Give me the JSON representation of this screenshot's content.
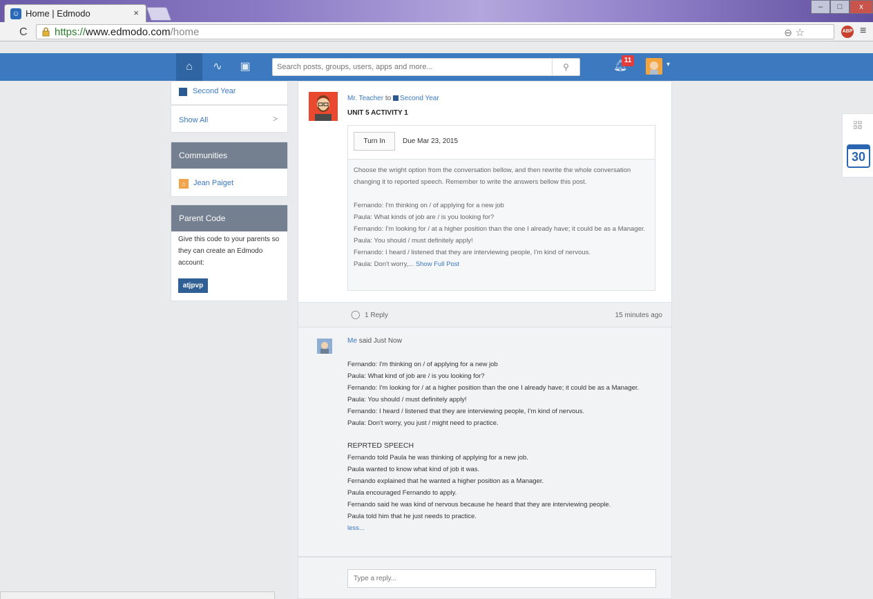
{
  "browser": {
    "tab_title": "Home | Edmodo",
    "tab_close": "×",
    "url_scheme": "https://",
    "url_host": "www.edmodo.com",
    "url_path": "/home",
    "abp_label": "ABP"
  },
  "nav": {
    "search_placeholder": "Search posts, groups, users, apps and more...",
    "notification_count": "11",
    "brand_color": "#3c79bf"
  },
  "sidebar": {
    "group_name": "Second Year",
    "show_all": "Show All",
    "communities_title": "Communities",
    "community_name": "Jean Paiget",
    "parent_code_title": "Parent Code",
    "parent_code_desc": "Give this code to your parents so they can create an Edmodo account:",
    "parent_code": "atjpvp"
  },
  "post": {
    "author": "Mr. Teacher",
    "to_word": "to",
    "group": "Second Year",
    "title": "UNIT 5 ACTIVITY 1",
    "turn_in": "Turn In",
    "due": "Due Mar 23, 2015",
    "instructions": "Choose the wright option from the conversation bellow, and then rewrite the whole conversation changing it to reported speech. Remember to write the answers bellow this post.",
    "lines": [
      "Fernando: I'm thinking on / of applying for a new job",
      "Paula: What kinds of job are / is you looking for?",
      "Fernando: I'm looking for / at a higher position than the one I already have; it could be as a Manager.",
      "Paula: You should / must definitely apply!",
      "Fernando: I heard / listened that they are interviewing people, I'm kind of nervous."
    ],
    "last_line": "Paula: Don't worry,...",
    "show_full": "Show Full Post",
    "reply_count": "1 Reply",
    "time_ago": "15 minutes ago"
  },
  "comment": {
    "author": "Me",
    "said": "said Just Now",
    "lines": [
      "Fernando: I'm thinking on / of applying for a new job",
      "Paula: What kind of job are / is you looking for?",
      "Fernando: I'm looking for / at a higher position than the one I already have; it could be as a Manager.",
      "Paula: You should / must definitely apply!",
      "Fernando: I heard / listened that they are interviewing people, I'm kind of nervous.",
      "Paula: Don't worry, you just / might need to practice."
    ],
    "heading": "REPRTED SPEECH",
    "reported": [
      "Fernando told Paula he was thinking of applying for a new job.",
      "Paula wanted to know what kind of job it was.",
      "Fernando explained that he wanted a higher position as a Manager.",
      "Paula encouraged Fernando to apply.",
      "Fernando said he was kind of nervous because he heard that they are interviewing people.",
      "Paula told him that he just needs to practice."
    ],
    "less": "less..."
  },
  "reply_form": {
    "placeholder": "Type a reply..."
  },
  "widget": {
    "calendar_day": "30"
  }
}
